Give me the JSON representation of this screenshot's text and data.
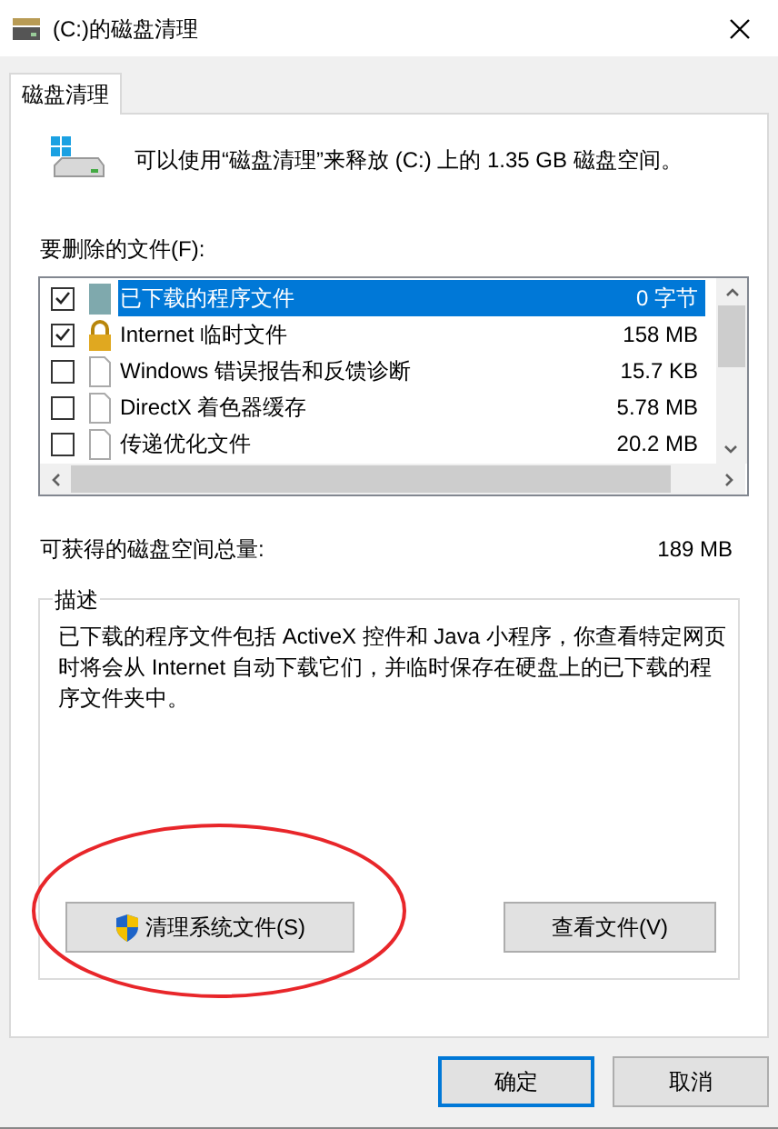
{
  "window": {
    "title": "(C:)的磁盘清理"
  },
  "tabs": [
    {
      "label": "磁盘清理",
      "selected": true
    }
  ],
  "intro": "可以使用“磁盘清理”来释放 (C:) 上的 1.35 GB 磁盘空间。",
  "files_label": "要删除的文件(F):",
  "files": [
    {
      "kind": "program",
      "name": "已下载的程序文件",
      "size": "0 字节",
      "checked": true,
      "selected": true
    },
    {
      "kind": "lock",
      "name": "Internet 临时文件",
      "size": "158 MB",
      "checked": true,
      "selected": false
    },
    {
      "kind": "file",
      "name": "Windows 错误报告和反馈诊断",
      "size": "15.7 KB",
      "checked": false,
      "selected": false
    },
    {
      "kind": "file",
      "name": "DirectX 着色器缓存",
      "size": "5.78 MB",
      "checked": false,
      "selected": false
    },
    {
      "kind": "file",
      "name": "传递优化文件",
      "size": "20.2 MB",
      "checked": false,
      "selected": false
    }
  ],
  "total_label": "可获得的磁盘空间总量:",
  "total_value": "189 MB",
  "description": {
    "title": "描述",
    "text": "已下载的程序文件包括 ActiveX 控件和 Java 小程序，你查看特定网页时将会从 Internet 自动下载它们，并临时保存在硬盘上的已下载的程序文件夹中。"
  },
  "clean_system_button": "清理系统文件(S)",
  "view_files_button": "查看文件(V)",
  "buttons": [
    {
      "label": "确定",
      "default": true
    },
    {
      "label": "取消",
      "default": false
    }
  ]
}
